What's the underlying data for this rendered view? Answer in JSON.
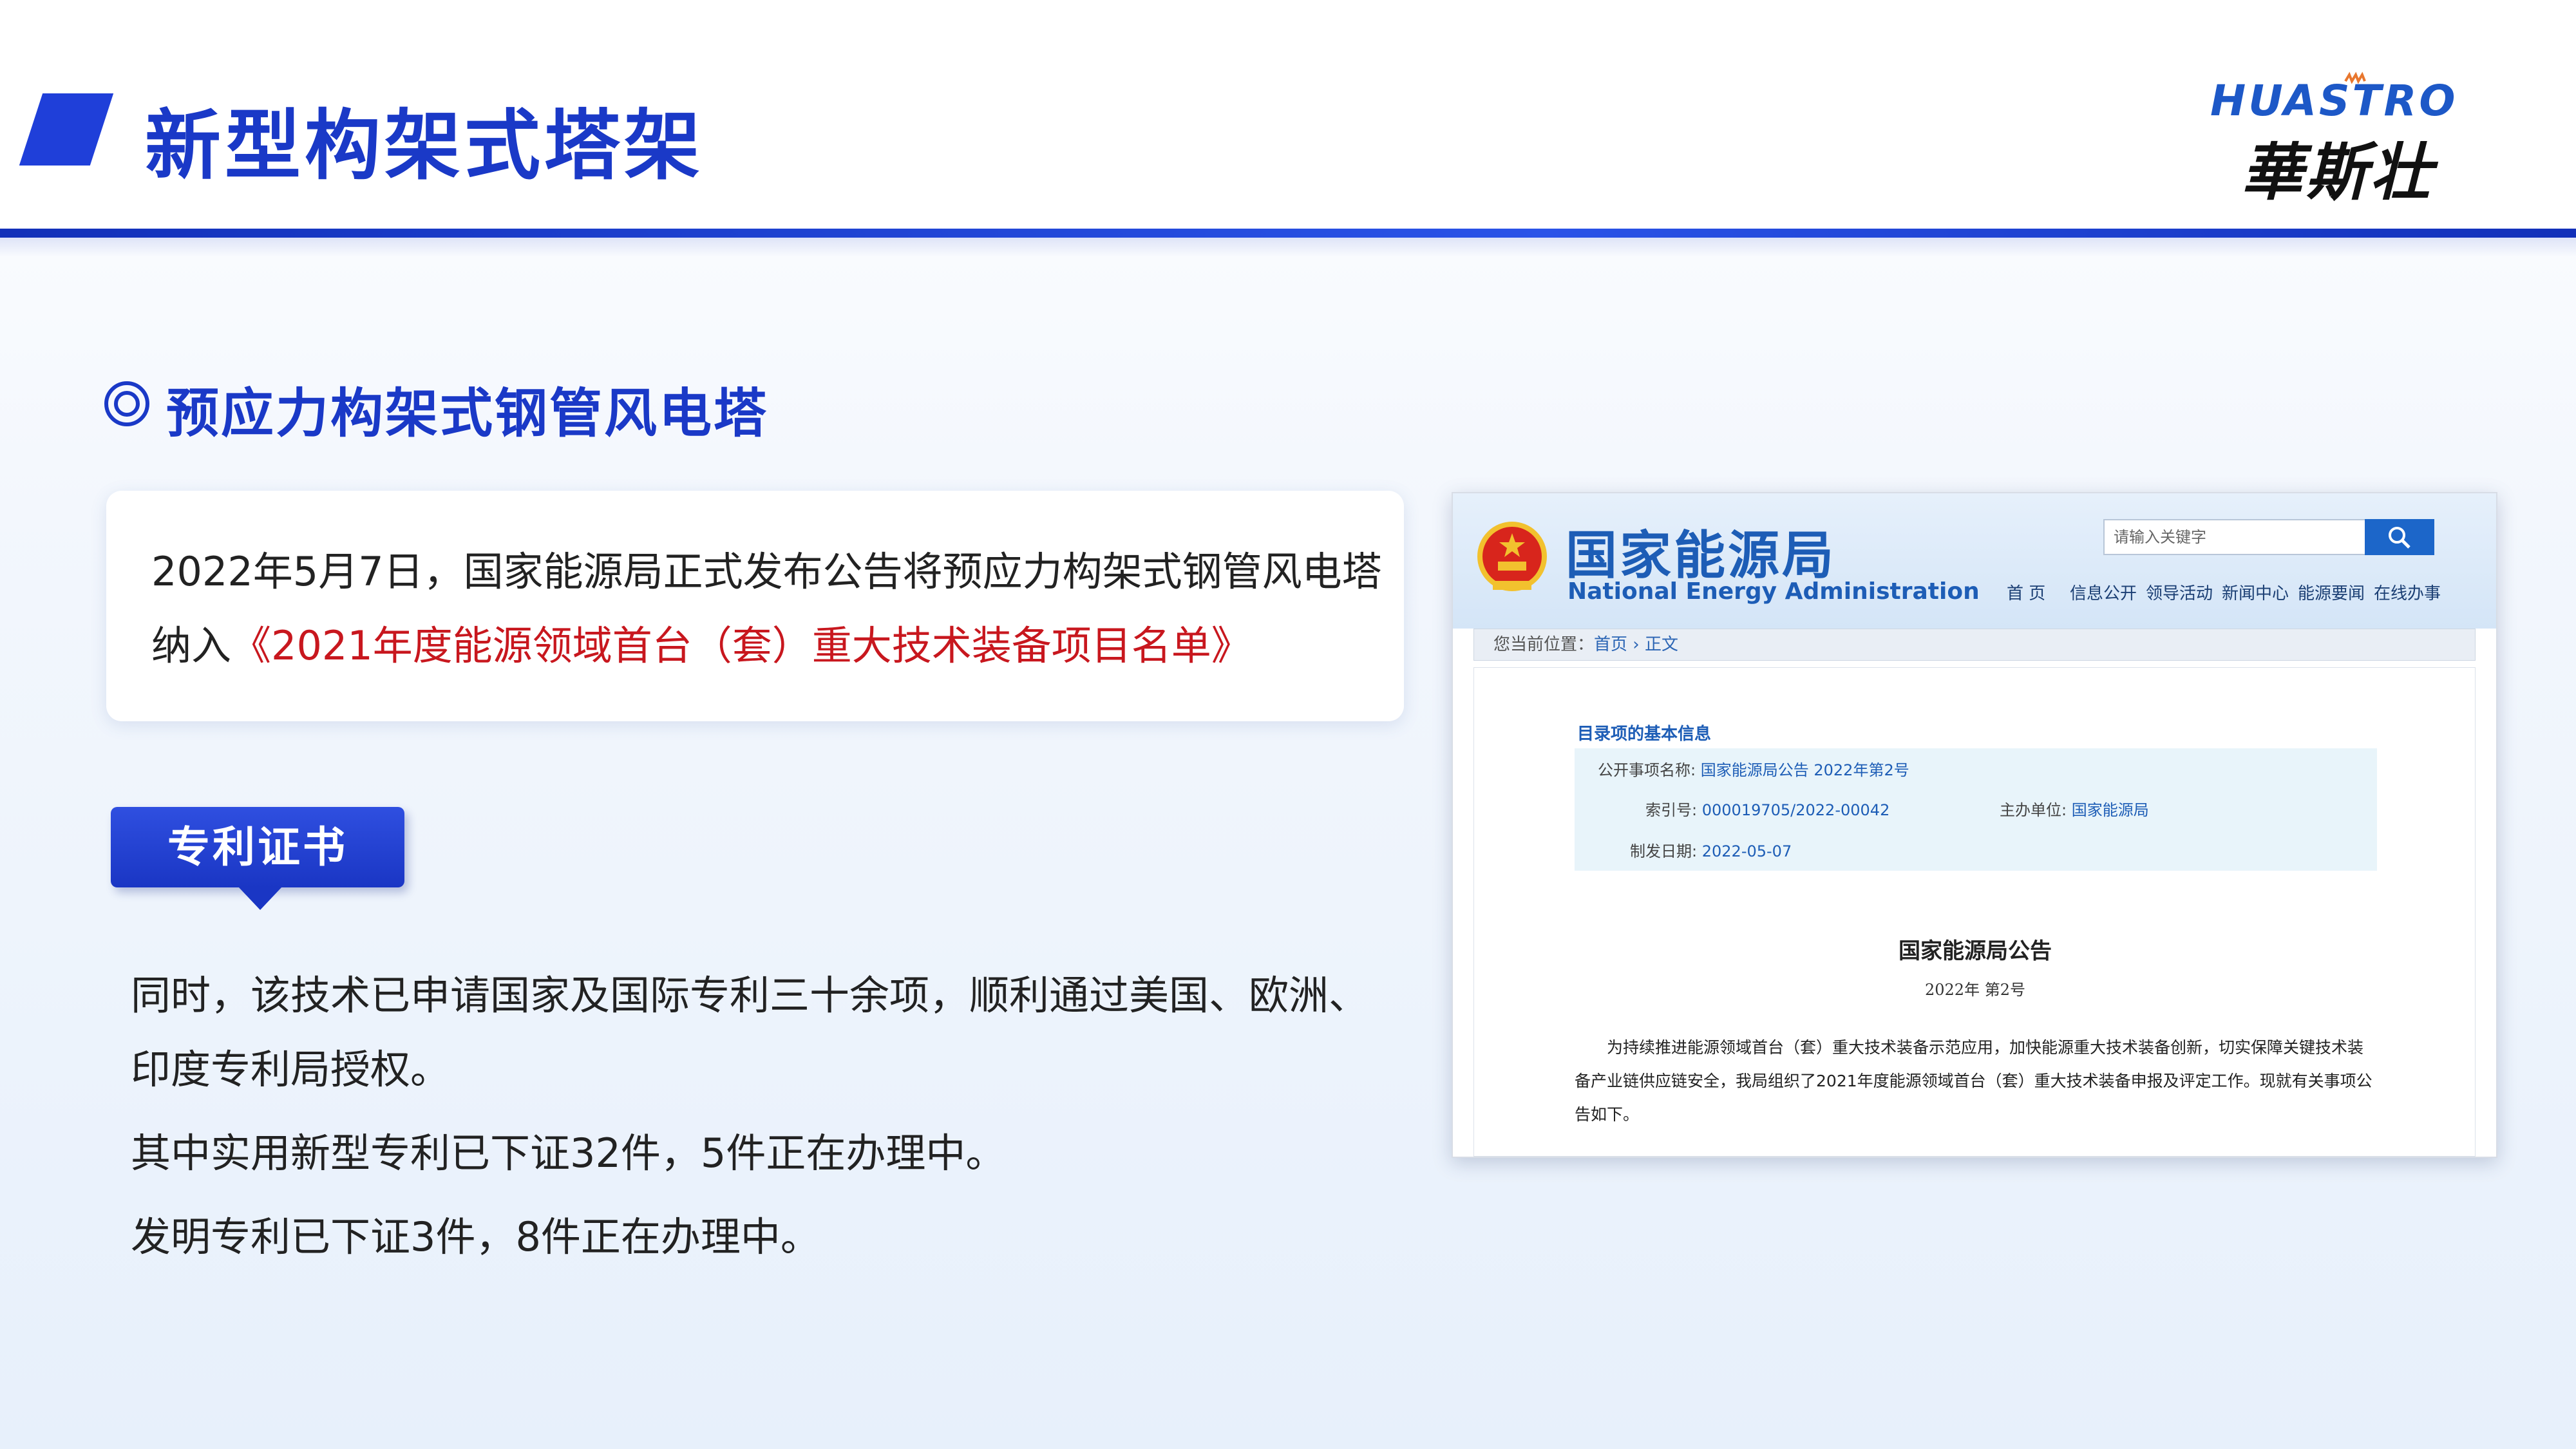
{
  "header": {
    "title": "新型构架式塔架",
    "logo_en": "HUASTRO",
    "logo_cn": "華斯壮"
  },
  "section": {
    "title": "预应力构架式钢管风电塔"
  },
  "intro": {
    "line1": "2022年5月7日，国家能源局正式发布公告将预应力构架式钢管风电塔",
    "line2_prefix": "纳入",
    "line2_highlight": "《2021年度能源领域首台（套）重大技术装备项目名单》"
  },
  "patent": {
    "tag_label": "专利证书",
    "para1_line1": "同时，该技术已申请国家及国际专利三十余项，顺利通过美国、欧洲、",
    "para1_line2": "印度专利局授权。",
    "para2": "其中实用新型专利已下证32件，5件正在办理中。",
    "para3": "发明专利已下证3件，8件正在办理中。"
  },
  "screenshot": {
    "site_name_cn": "国家能源局",
    "site_name_en": "National Energy Administration",
    "search_placeholder": "请输入关键字",
    "nav": [
      "首 页",
      "信息公开",
      "领导活动",
      "新闻中心",
      "能源要闻",
      "在线办事"
    ],
    "breadcrumb_label": "您当前位置：",
    "breadcrumb": "首页 › 正文",
    "info_section": "目录项的基本信息",
    "info": {
      "item_name_key": "公开事项名称:",
      "item_name_val": "国家能源局公告 2022年第2号",
      "index_key": "索引号:",
      "index_val": "000019705/2022-00042",
      "publisher_key": "主办单位:",
      "publisher_val": "国家能源局",
      "date_key": "制发日期:",
      "date_val": "2022-05-07"
    },
    "doc_title": "国家能源局公告",
    "doc_number": "2022年 第2号",
    "doc_body": [
      "　　为持续推进能源领域首台（套）重大技术装备示范应用，加快能源重大技术装备创新，切实保障关键技术装",
      "备产业链供应链安全，我局组织了2021年度能源领域首台（套）重大技术装备申报及评定工作。现就有关事项公",
      "告如下。"
    ]
  },
  "colors": {
    "brand_blue": "#1a39c7",
    "highlight_red": "#c8171e",
    "nea_blue": "#1d5db6"
  }
}
